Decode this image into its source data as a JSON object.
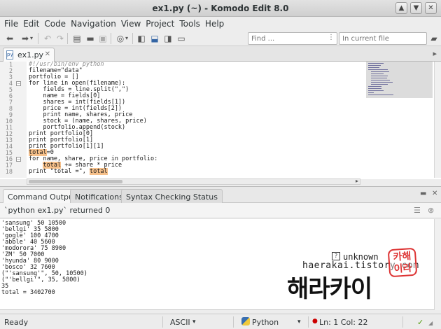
{
  "window": {
    "title": "ex1.py (~) - Komodo Edit 8.0",
    "buttons": [
      "▲",
      "▼",
      "✕"
    ]
  },
  "menu": [
    "File",
    "Edit",
    "Code",
    "Navigation",
    "View",
    "Project",
    "Tools",
    "Help"
  ],
  "toolbar": {
    "find_placeholder": "Find ...",
    "file_placeholder": "In current file"
  },
  "tab": {
    "name": "ex1.py",
    "icon_text": "py"
  },
  "editor": {
    "line_numbers": [
      "1",
      "2",
      "3",
      "4",
      "5",
      "6",
      "7",
      "8",
      "9",
      "10",
      "11",
      "12",
      "13",
      "14",
      "15",
      "16",
      "17",
      "18"
    ],
    "lines": [
      "#!/usr/bin/env python",
      "filename=\"data\"",
      "portfolio = []",
      "for line in open(filename):",
      "    fields = line.split(\",\")",
      "    name = fields[0]",
      "    shares = int(fields[1])",
      "    price = int(fields[2])",
      "    print name, shares, price",
      "    stock = (name, shares, price)",
      "    portfolio.append(stock)",
      "print portfolio[0]",
      "print portfolio[1]",
      "print portfolio[1][1]",
      "total=0",
      "for name, share, price in portfolio:",
      "    total += share * price",
      "print \"total =\", total"
    ],
    "highlight_word": "total"
  },
  "bottom_tabs": [
    "Command Output",
    "Notifications",
    "Syntax Checking Status"
  ],
  "command_output": {
    "header": "`python ex1.py` returned 0",
    "lines": [
      "'sansung' 50 10500",
      "'bellgi' 35 5800",
      "'gogle' 100 4700",
      "'abble' 40 5600",
      "'modorora' 75 8900",
      "'ZM' 50 7000",
      "'hyunda' 80 9000",
      "'bosco' 32 7600",
      "(\"'sansung'\", 50, 10500)",
      "(\"'bellgi'\", 35, 5800)",
      "35",
      "total = 3402700"
    ]
  },
  "watermark": {
    "tag": "unknown",
    "blog": "haerakai.tistory.com",
    "name": "해라카이",
    "stamp": "카해이라"
  },
  "status": {
    "state": "Ready",
    "encoding": "ASCII",
    "language": "Python",
    "position": "Ln: 1 Col: 22"
  }
}
